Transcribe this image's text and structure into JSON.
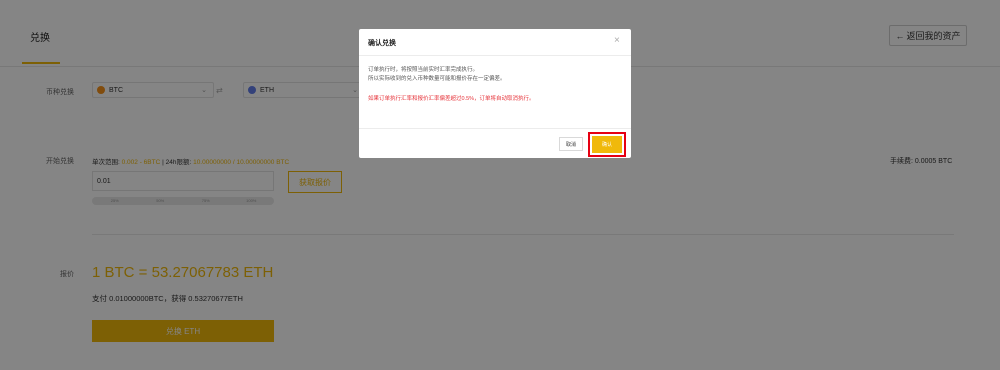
{
  "header": {
    "tab_label": "兑换",
    "back_label": "返回我的资产",
    "back_icon": "arrow-left-icon"
  },
  "currency_row": {
    "label": "币种兑换",
    "from": {
      "coin": "BTC",
      "color": "#f7931a"
    },
    "to": {
      "coin": "ETH",
      "color": "#627eea"
    },
    "swap_icon": "exchange-arrows-icon"
  },
  "exchange_row": {
    "label": "开始兑换",
    "limit_prefix": "单次范围:",
    "limit_range": "0.002 - 6BTC",
    "daily_prefix": "| 24h限额:",
    "daily_range": "10.00000000 / 10.00000000 BTC",
    "fee": "手续费: 0.0005 BTC",
    "amount_value": "0.01",
    "quote_button": "获取报价",
    "percentages": [
      "25%",
      "50%",
      "75%",
      "100%"
    ]
  },
  "quote_row": {
    "label": "报价",
    "rate": "1 BTC = 53.27067783 ETH",
    "summary": "支付 0.01000000BTC，获得 0.53270677ETH",
    "confirm_button": "兑换 ETH"
  },
  "modal": {
    "title": "确认兑换",
    "line1": "订单执行时，将按照当前实时汇率完成执行。",
    "line2": "所以实际收到的兑入币种数量可能和报价存在一定偏差。",
    "warning": "如果订单执行汇率和报价汇率偏差超过0.5%，订单将自动取消执行。",
    "cancel_label": "取消",
    "ok_label": "确认",
    "highlight_color": "#e60012"
  },
  "colors": {
    "accent": "#f0b90b",
    "warning": "#e6343b"
  }
}
